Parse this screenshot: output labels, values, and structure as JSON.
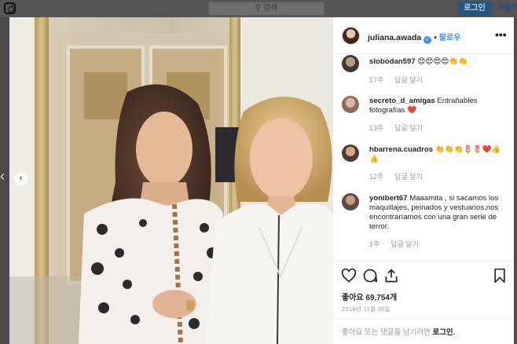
{
  "topbar": {
    "search_placeholder": "검색",
    "login_label": "로그인",
    "signup_label": "가입하"
  },
  "post": {
    "username": "juliana.awada",
    "follow_label": "팔로우",
    "likes_text": "좋아요 69,754개",
    "date": "2018년 11월 30일",
    "login_prompt": "좋아요 또는 댓글을 남기려면",
    "login_link": "로그인."
  },
  "comments": [
    {
      "user": "slobodan597",
      "text": "😍😍😍😍👏👏",
      "time": "17주",
      "reply": "답글 달기"
    },
    {
      "user": "secreto_d_amigas",
      "text": "Entrañables fotografías ❤️",
      "time": "13주",
      "reply": "답글 달기"
    },
    {
      "user": "hbarrena.cuadros",
      "text": "👏👏👏🌷🌷❤️👍👍",
      "time": "12주",
      "reply": "답글 달기"
    },
    {
      "user": "yonibert67",
      "text": "Maaamita , si sacamos los maquillajes, peinados y vestuarios.nos encontraríamos con una gran serie de terror.",
      "time": "1주",
      "reply": "답글 달기"
    }
  ],
  "icons": {
    "logo": "instagram-logo-icon",
    "search": "search-icon",
    "prev": "chevron-left-icon",
    "verified": "verified-badge-icon",
    "more": "more-options-icon",
    "like": "heart-icon",
    "comment": "comment-icon",
    "share": "share-icon",
    "save": "bookmark-icon"
  },
  "colors": {
    "accent": "#3897f0",
    "muted": "#999999",
    "text": "#262626"
  }
}
